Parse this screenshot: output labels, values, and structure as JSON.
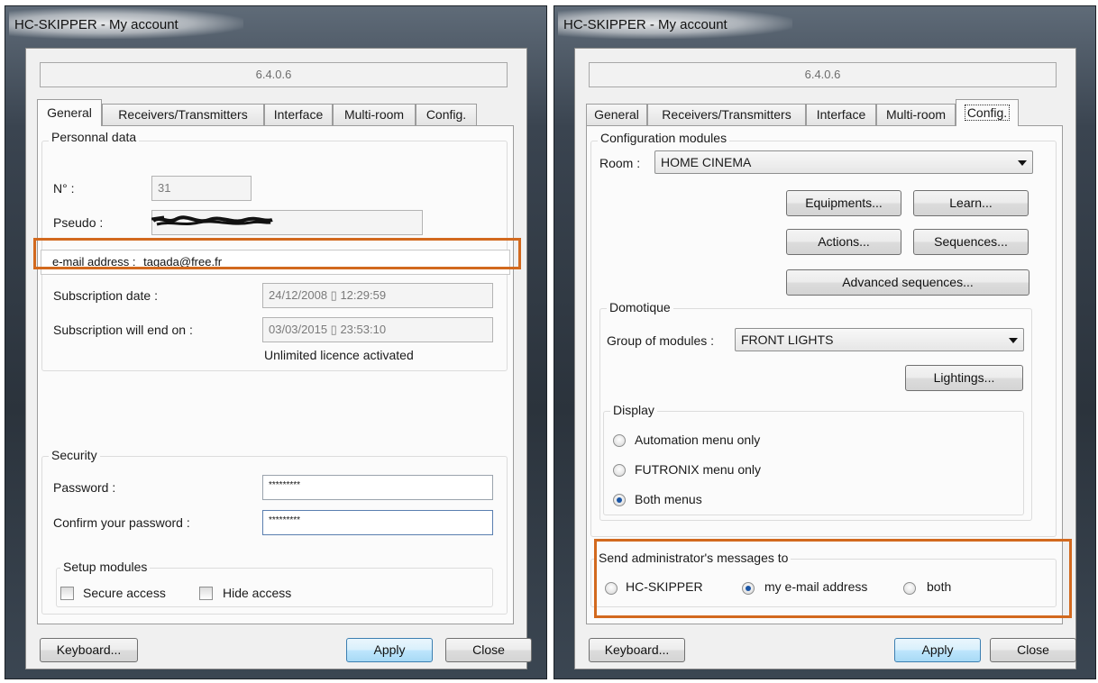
{
  "windows": [
    {
      "title": "HC-SKIPPER - My account",
      "version": "6.4.0.6",
      "tabs": [
        "General",
        "Receivers/Transmitters",
        "Interface",
        "Multi-room",
        "Config."
      ],
      "personal": {
        "group_label": "Personnal data",
        "number_label": "N° :",
        "number_value": "31",
        "pseudo_label": "Pseudo :",
        "email_label": "e-mail address :",
        "email_value": "tagada@free.fr",
        "subscription_date_label": "Subscription date :",
        "subscription_date_value": "24/12/2008 ▯ 12:29:59",
        "subscription_end_label": "Subscription will end on :",
        "subscription_end_value": "03/03/2015 ▯ 23:53:10",
        "licence_status": "Unlimited licence activated"
      },
      "security": {
        "group_label": "Security",
        "password_label": "Password :",
        "password_value": "*********",
        "confirm_label": "Confirm your password :",
        "confirm_value": "*********",
        "setup_group_label": "Setup modules",
        "secure_access_label": "Secure access",
        "hide_access_label": "Hide access"
      },
      "buttons": {
        "keyboard": "Keyboard...",
        "apply": "Apply",
        "close": "Close"
      }
    },
    {
      "title": "HC-SKIPPER - My account",
      "version": "6.4.0.6",
      "tabs": [
        "General",
        "Receivers/Transmitters",
        "Interface",
        "Multi-room",
        "Config."
      ],
      "config": {
        "group_label": "Configuration modules",
        "room_label": "Room :",
        "room_value": "HOME CINEMA",
        "equipments_button": "Equipments...",
        "learn_button": "Learn...",
        "actions_button": "Actions...",
        "sequences_button": "Sequences...",
        "advanced_sequences_button": "Advanced sequences...",
        "domotique_label": "Domotique",
        "group_modules_label": "Group of modules :",
        "group_modules_value": "FRONT LIGHTS",
        "lightings_button": "Lightings...",
        "display_label": "Display",
        "display_options": [
          "Automation menu only",
          "FUTRONIX menu only",
          "Both menus"
        ],
        "display_selected": "Both menus",
        "admin_label": "Send administrator's messages to",
        "admin_options": [
          "HC-SKIPPER",
          "my e-mail address",
          "both"
        ],
        "admin_selected": "my e-mail address"
      },
      "buttons": {
        "keyboard": "Keyboard...",
        "apply": "Apply",
        "close": "Close"
      }
    }
  ],
  "colors": {
    "highlight": "#d2691e",
    "selected_radio": "#1a55a5"
  }
}
